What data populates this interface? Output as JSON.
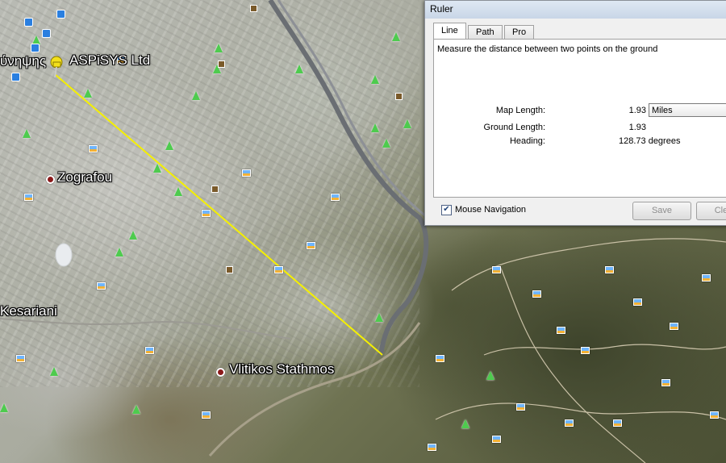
{
  "map": {
    "labels": {
      "aspisys": "ASPiSYS Ltd",
      "aspisys_prefix": "ύνηψης",
      "zografou": "Zografou",
      "kesariani": "Kesariani",
      "vlitikos": "Vlitikos Stathmos"
    },
    "ruler_line_color": "#f5f000"
  },
  "ruler": {
    "title": "Ruler",
    "tabs": [
      "Line",
      "Path",
      "Pro"
    ],
    "active_tab": "Line",
    "description": "Measure the distance between two points on the ground",
    "map_length_label": "Map Length:",
    "map_length_value": "1.93",
    "units": "Miles",
    "ground_length_label": "Ground Length:",
    "ground_length_value": "1.93",
    "heading_label": "Heading:",
    "heading_value": "128.73 degrees",
    "mouse_navigation_label": "Mouse Navigation",
    "mouse_navigation_checked": true,
    "save_label": "Save",
    "clear_label": "Cle"
  }
}
